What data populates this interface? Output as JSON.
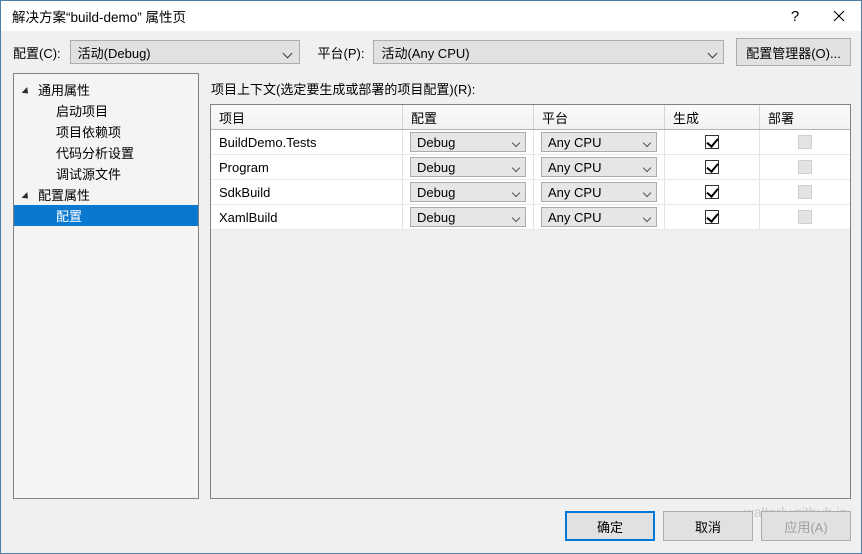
{
  "window": {
    "title": "解决方案“build-demo” 属性页",
    "help_glyph": "?",
    "close_glyph": "✕"
  },
  "topbar": {
    "config_label": "配置(C):",
    "config_value": "活动(Debug)",
    "platform_label": "平台(P):",
    "platform_value": "活动(Any CPU)",
    "config_manager_button": "配置管理器(O)..."
  },
  "tree": {
    "nodes": [
      {
        "label": "通用属性",
        "level": "group",
        "expanded": true,
        "selected": false
      },
      {
        "label": "启动项目",
        "level": "child",
        "expanded": false,
        "selected": false
      },
      {
        "label": "项目依赖项",
        "level": "child",
        "expanded": false,
        "selected": false
      },
      {
        "label": "代码分析设置",
        "level": "child",
        "expanded": false,
        "selected": false
      },
      {
        "label": "调试源文件",
        "level": "child",
        "expanded": false,
        "selected": false
      },
      {
        "label": "配置属性",
        "level": "group",
        "expanded": true,
        "selected": false
      },
      {
        "label": "配置",
        "level": "child",
        "expanded": false,
        "selected": true
      }
    ]
  },
  "main": {
    "context_label": "项目上下文(选定要生成或部署的项目配置)(R):",
    "columns": [
      "项目",
      "配置",
      "平台",
      "生成",
      "部署"
    ],
    "rows": [
      {
        "project": "BuildDemo.Tests",
        "config": "Debug",
        "platform": "Any CPU",
        "build": true,
        "deploy": false,
        "deploy_enabled": false
      },
      {
        "project": "Program",
        "config": "Debug",
        "platform": "Any CPU",
        "build": true,
        "deploy": false,
        "deploy_enabled": false
      },
      {
        "project": "SdkBuild",
        "config": "Debug",
        "platform": "Any CPU",
        "build": true,
        "deploy": false,
        "deploy_enabled": false
      },
      {
        "project": "XamlBuild",
        "config": "Debug",
        "platform": "Any CPU",
        "build": true,
        "deploy": false,
        "deploy_enabled": false
      }
    ]
  },
  "footer": {
    "ok_label": "确定",
    "cancel_label": "取消",
    "apply_label": "应用(A)",
    "apply_disabled": true,
    "watermark": "walterlv.github.io"
  },
  "colors": {
    "accent": "#0b78d0",
    "window_border": "#4d7ea8",
    "dialog_bg": "#f0f0f0",
    "titlebar_bg": "#ffffff",
    "control_bg": "#e1e1e1",
    "control_border": "#adadad",
    "panel_border": "#828282",
    "watermark": "#c9c9c9"
  }
}
